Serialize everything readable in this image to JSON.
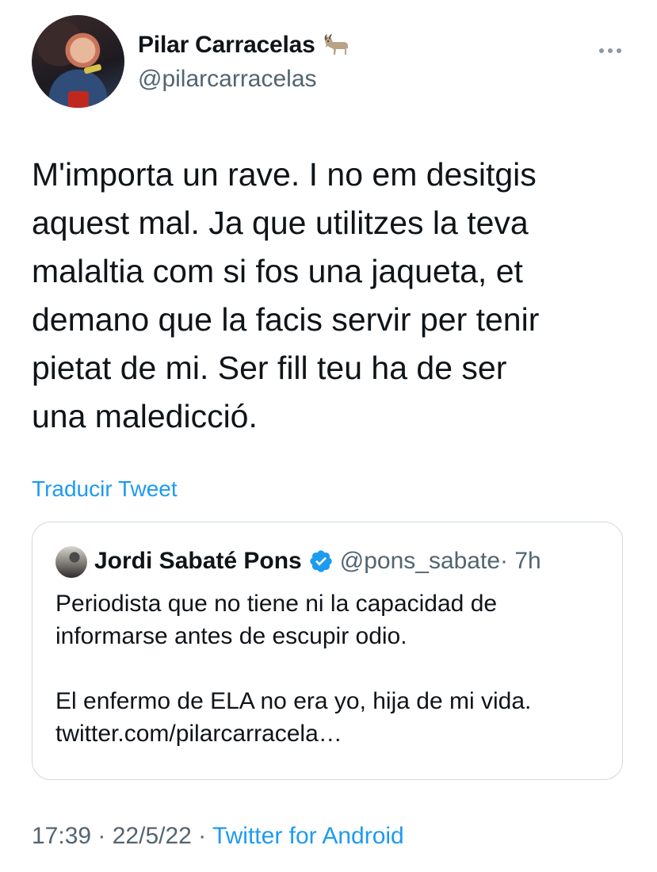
{
  "author": {
    "display_name": "Pilar Carracelas",
    "handle": "@pilarcarracelas",
    "name_emoji_icon": "goat-emoji"
  },
  "more_icon": "more-horizontal-icon",
  "tweet": {
    "text": "M'importa un rave. I no em desitgis\naquest mal. Ja que utilitzes la teva\nmalaltia com si fos una jaqueta, et\ndemano que la facis servir per tenir\npietat de mi. Ser fill teu ha de ser\nuna maledicció."
  },
  "translate_label": "Traducir Tweet",
  "quoted_tweet": {
    "display_name": "Jordi Sabaté Pons",
    "verified_icon": "verified-badge-icon",
    "handle": "@pons_sabate",
    "time": " · 7h",
    "text": "Periodista que no tiene ni la capacidad de\ninformarse antes de escupir odio.\n\nEl enfermo de ELA no era yo, hija de mi vida.\ntwitter.com/pilarcarracela…"
  },
  "footer": {
    "time": "17:39",
    "sep1": " · ",
    "date": "22/5/22",
    "sep2": " · ",
    "source": "Twitter for Android"
  },
  "colors": {
    "accent": "#1d9bf0",
    "text_primary": "#0f1419",
    "text_secondary": "#536471",
    "border": "#cfd9de"
  }
}
